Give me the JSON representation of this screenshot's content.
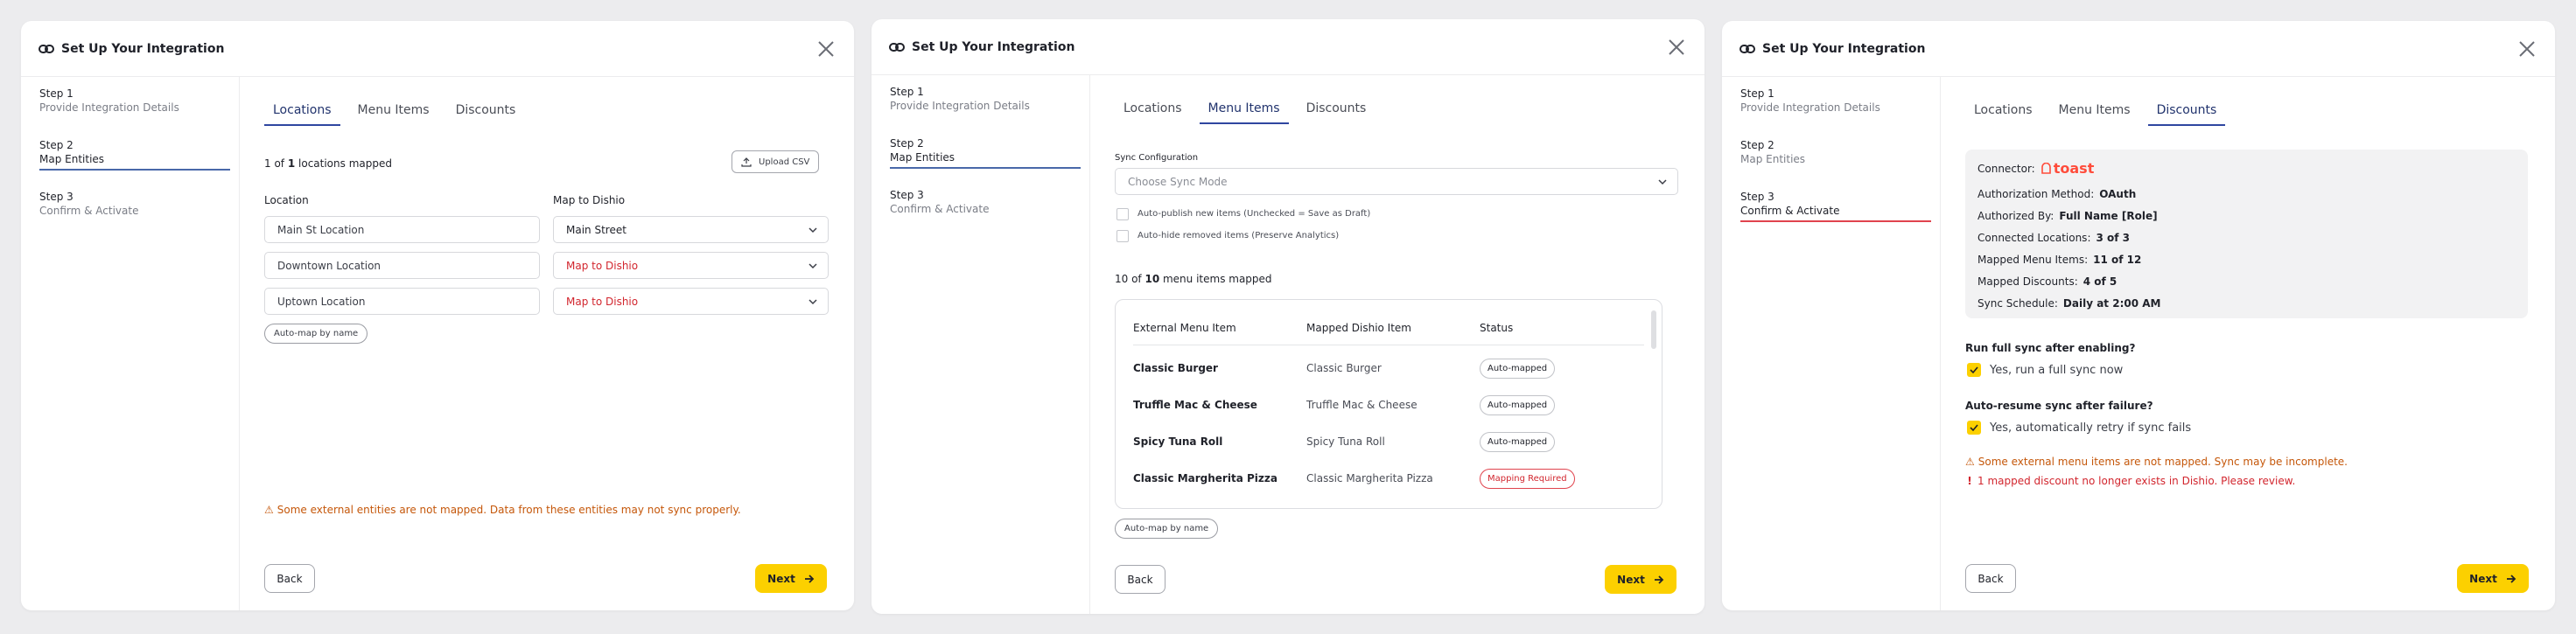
{
  "app": {
    "title": "Set Up Your Integration"
  },
  "steps": [
    {
      "num": "Step 1",
      "name": "Provide Integration Details"
    },
    {
      "num": "Step 2",
      "name": "Map Entities"
    },
    {
      "num": "Step 3",
      "name": "Confirm & Activate"
    }
  ],
  "tabs": {
    "locations": "Locations",
    "menu_items": "Menu Items",
    "discounts": "Discounts"
  },
  "locations": {
    "count_prefix": "1 of ",
    "count_bold": "1",
    "count_suffix": " locations mapped",
    "upload_label": "Upload CSV",
    "col_location": "Location",
    "col_map": "Map to Dishio",
    "rows": [
      {
        "location": "Main St Location",
        "mapped": "Main Street",
        "unmapped": false
      },
      {
        "location": "Downtown Location",
        "mapped": "Map to Dishio",
        "unmapped": true
      },
      {
        "location": "Uptown Location",
        "mapped": "Map to Dishio",
        "unmapped": true
      }
    ],
    "automap": "Auto-map by name",
    "warning": "Some external entities are not mapped. Data from these entities may not sync properly."
  },
  "menu": {
    "sync_label": "Sync Configuration",
    "sync_placeholder": "Choose Sync Mode",
    "opt1": "Auto-publish new items (Unchecked = Save as Draft)",
    "opt2": "Auto-hide removed items (Preserve Analytics)",
    "count_prefix": "10 of ",
    "count_bold": "10",
    "count_suffix": " menu items mapped",
    "headers": [
      "External Menu Item",
      "Mapped Dishio Item",
      "Status"
    ],
    "rows": [
      {
        "ext": "Classic Burger",
        "mapped": "Classic Burger",
        "status": "Auto-mapped"
      },
      {
        "ext": "Truffle Mac & Cheese",
        "mapped": "Truffle Mac & Cheese",
        "status": "Auto-mapped"
      },
      {
        "ext": "Spicy Tuna Roll",
        "mapped": "Spicy Tuna Roll",
        "status": "Auto-mapped"
      },
      {
        "ext": "Classic Margherita Pizza",
        "mapped": "Classic Margherita Pizza",
        "status": "Mapping Required"
      }
    ],
    "automap": "Auto-map by name"
  },
  "confirm": {
    "connector_label": "Connector:",
    "connector_value": "toast",
    "rows": [
      {
        "label": "Authorization Method:",
        "value": "OAuth"
      },
      {
        "label": "Authorized By:",
        "value": "Full Name [Role]"
      },
      {
        "label": "Connected Locations:",
        "value": "3 of 3"
      },
      {
        "label": "Mapped Menu Items:",
        "value": "11 of 12"
      },
      {
        "label": "Mapped Discounts:",
        "value": "4 of 5"
      },
      {
        "label": "Sync Schedule:",
        "value": "Daily at 2:00 AM"
      }
    ],
    "q1": "Run full sync after enabling?",
    "a1": "Yes, run a full sync now",
    "q2": "Auto-resume sync after failure?",
    "a2": "Yes, automatically retry if sync fails",
    "warning": "Some external menu items are not mapped. Sync may be incomplete.",
    "error": "1 mapped discount no longer exists in Dishio. Please review."
  },
  "buttons": {
    "back": "Back",
    "next": "Next"
  },
  "colors": {
    "accent": "#fcd000",
    "tab_active": "#2f46a0",
    "error": "#d2262e",
    "warning": "#c5570a",
    "toast": "#ff4c3b"
  }
}
